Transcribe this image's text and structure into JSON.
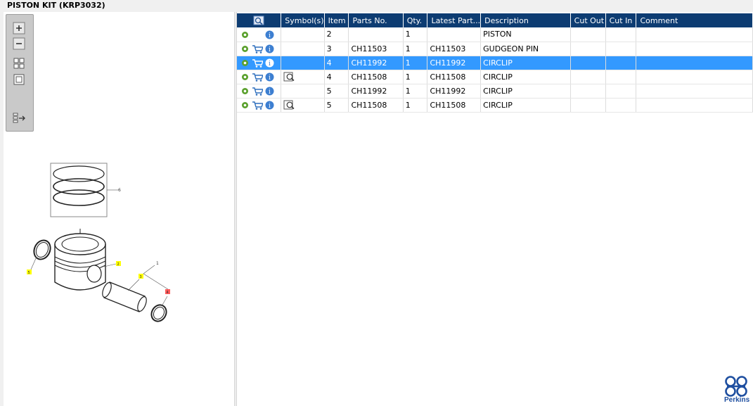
{
  "window": {
    "title": "PISTON KIT (KRP3032)"
  },
  "zoom_toolbar": {
    "buttons": [
      "zoom-in-icon",
      "zoom-out-icon",
      "fit-all-icon",
      "fit-window-icon",
      "panel-toggle-icon"
    ]
  },
  "diagram": {
    "labels": [
      "6",
      "5",
      "2",
      "3",
      "1",
      "4"
    ],
    "highlight_yellow": "#ffff00",
    "highlight_red": "#ff5a5a"
  },
  "grid": {
    "columns": {
      "icon": "search-icon",
      "symbols": "Symbol(s)",
      "item": "Item",
      "parts_no": "Parts No.",
      "qty": "Qty.",
      "latest_part": "Latest Part...",
      "description": "Description",
      "cut_out": "Cut Out",
      "cut_in": "Cut In",
      "comment": "Comment"
    },
    "rows": [
      {
        "item": "2",
        "parts_no": "",
        "qty": "1",
        "latest_part": "",
        "description": "PISTON",
        "cut_out": "",
        "cut_in": "",
        "comment": ""
      },
      {
        "item": "3",
        "parts_no": "CH11503",
        "qty": "1",
        "latest_part": "CH11503",
        "description": "GUDGEON PIN",
        "cut_out": "",
        "cut_in": "",
        "comment": ""
      },
      {
        "item": "4",
        "parts_no": "CH11992",
        "qty": "1",
        "latest_part": "CH11992",
        "description": "CIRCLIP",
        "cut_out": "",
        "cut_in": "",
        "comment": ""
      },
      {
        "item": "4",
        "parts_no": "CH11508",
        "qty": "1",
        "latest_part": "CH11508",
        "description": "CIRCLIP",
        "cut_out": "",
        "cut_in": "",
        "comment": ""
      },
      {
        "item": "5",
        "parts_no": "CH11992",
        "qty": "1",
        "latest_part": "CH11992",
        "description": "CIRCLIP",
        "cut_out": "",
        "cut_in": "",
        "comment": ""
      },
      {
        "item": "5",
        "parts_no": "CH11508",
        "qty": "1",
        "latest_part": "CH11508",
        "description": "CIRCLIP",
        "cut_out": "",
        "cut_in": "",
        "comment": ""
      }
    ],
    "selected_row_color": "#3399ff",
    "header_color": "#0d3c72"
  },
  "brand": {
    "logo_text": "Perkins",
    "color": "#1f4fa0"
  }
}
